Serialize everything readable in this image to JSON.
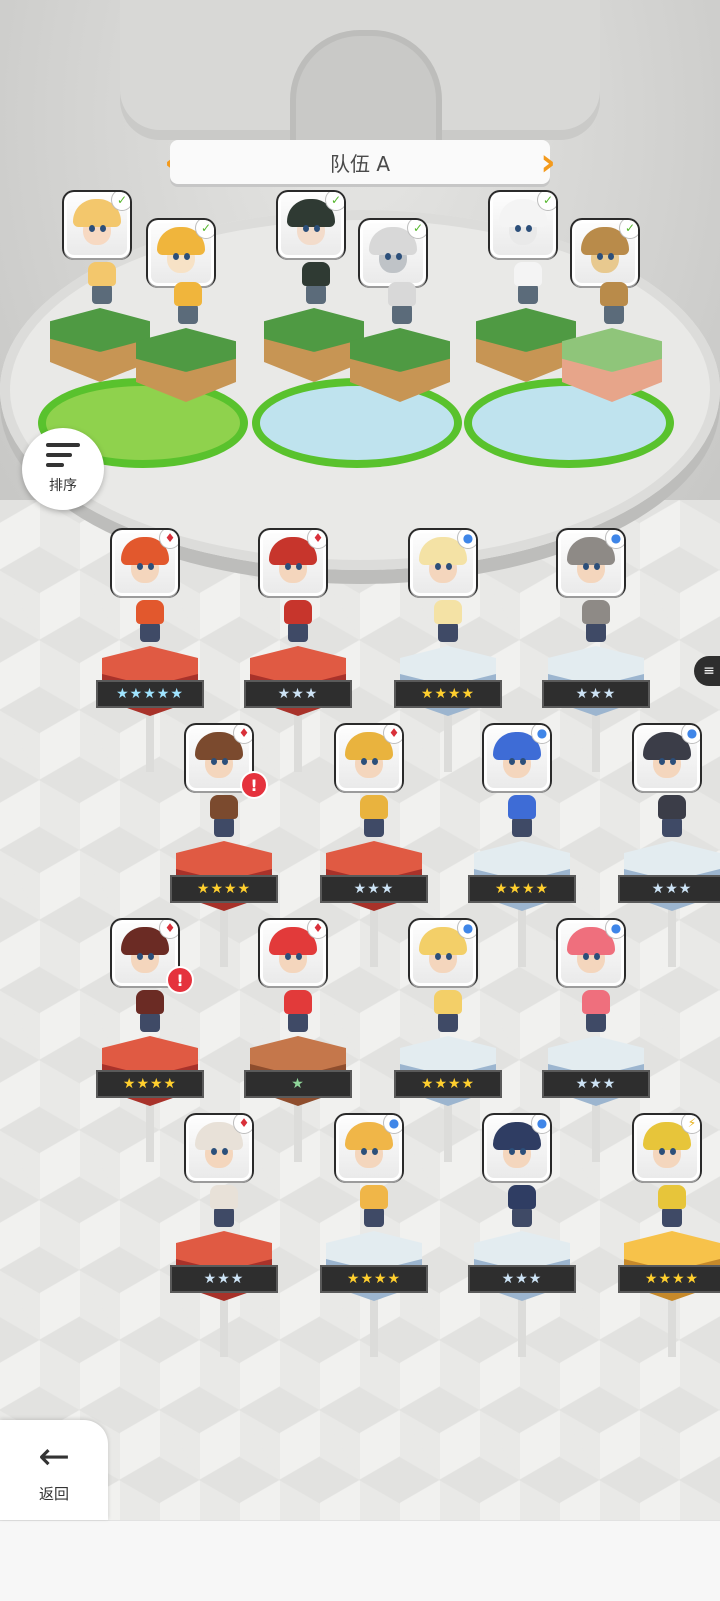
{
  "team": {
    "title": "队伍 A",
    "prev_icon": "chevron-left-icon",
    "next_icon": "chevron-right-icon",
    "members": [
      {
        "name": "blonde-swordswoman",
        "element": "grass",
        "hair": "#f3c76c",
        "skin": "#f7d9c2"
      },
      {
        "name": "fox-girl",
        "element": "grass",
        "hair": "#f0b53c",
        "skin": "#f7e2c6"
      },
      {
        "name": "dark-haired-girl",
        "element": "grass",
        "hair": "#2f3a33",
        "skin": "#f3dccb"
      },
      {
        "name": "white-tiger",
        "element": "grass",
        "hair": "#d8d8d8",
        "skin": "#bfc3c7"
      },
      {
        "name": "white-wolf-mage",
        "element": "grass",
        "hair": "#f4f4f4",
        "skin": "#e9e9e9"
      },
      {
        "name": "owl-sage",
        "element": "grass",
        "hair": "#b98b4a",
        "skin": "#e8c98f"
      }
    ]
  },
  "buttons": {
    "sort_label": "排序",
    "sort_icon": "sort-list-icon",
    "back_label": "返回",
    "back_icon": "arrow-left-icon",
    "side_icon": "stack-icon"
  },
  "roster": [
    {
      "name": "witch",
      "element": "fire",
      "stars": "★★★★★",
      "star_style": "rainbow",
      "pedestal": "fire",
      "hair": "#e2582d",
      "alert": false
    },
    {
      "name": "red-hair-hero",
      "element": "fire",
      "stars": "★★★",
      "star_style": "silver",
      "pedestal": "fire",
      "hair": "#c7352c",
      "alert": false
    },
    {
      "name": "blonde-princess",
      "element": "water",
      "stars": "★★★★",
      "star_style": "gold",
      "pedestal": "water",
      "hair": "#f4e2a5",
      "alert": false
    },
    {
      "name": "grey-wolf",
      "element": "water",
      "stars": "★★★",
      "star_style": "silver",
      "pedestal": "water",
      "hair": "#8e8a86",
      "alert": false
    },
    {
      "name": "brown-hair-boy",
      "element": "fire",
      "stars": "★★★★",
      "star_style": "gold",
      "pedestal": "fire",
      "hair": "#7b4a2e",
      "alert": true
    },
    {
      "name": "blonde-knight",
      "element": "fire",
      "stars": "★★★",
      "star_style": "silver",
      "pedestal": "fire",
      "hair": "#e9b33e",
      "alert": false
    },
    {
      "name": "blue-elf",
      "element": "water",
      "stars": "★★★★",
      "star_style": "gold",
      "pedestal": "water",
      "hair": "#3e6cd6",
      "alert": false
    },
    {
      "name": "dark-beast",
      "element": "water",
      "stars": "★★★",
      "star_style": "silver",
      "pedestal": "water",
      "hair": "#3b3d48",
      "alert": false
    },
    {
      "name": "masked-ninja",
      "element": "fire",
      "stars": "★★★★",
      "star_style": "gold",
      "pedestal": "fire",
      "hair": "#6b2b24",
      "alert": true
    },
    {
      "name": "red-slime",
      "element": "fire",
      "stars": "★",
      "star_style": "green",
      "pedestal": "earth",
      "hair": "#e23a3a",
      "alert": false
    },
    {
      "name": "blonde-maiden",
      "element": "water",
      "stars": "★★★★",
      "star_style": "gold",
      "pedestal": "water",
      "hair": "#f3cf68",
      "alert": false
    },
    {
      "name": "pink-hair-girl",
      "element": "water",
      "stars": "★★★",
      "star_style": "silver",
      "pedestal": "water",
      "hair": "#ef6f7d",
      "alert": false
    },
    {
      "name": "hooded-rogue",
      "element": "fire",
      "stars": "★★★",
      "star_style": "silver",
      "pedestal": "fire",
      "hair": "#e8e1d8",
      "alert": false
    },
    {
      "name": "blonde-boy",
      "element": "water",
      "stars": "★★★★",
      "star_style": "gold",
      "pedestal": "water",
      "hair": "#f0b648",
      "alert": false
    },
    {
      "name": "bearded-warrior",
      "element": "water",
      "stars": "★★★",
      "star_style": "silver",
      "pedestal": "water",
      "hair": "#2f3d63",
      "alert": false
    },
    {
      "name": "golden-dragon",
      "element": "thunder",
      "stars": "★★★★",
      "star_style": "gold",
      "pedestal": "gold",
      "hair": "#e7c53a",
      "alert": false
    }
  ]
}
